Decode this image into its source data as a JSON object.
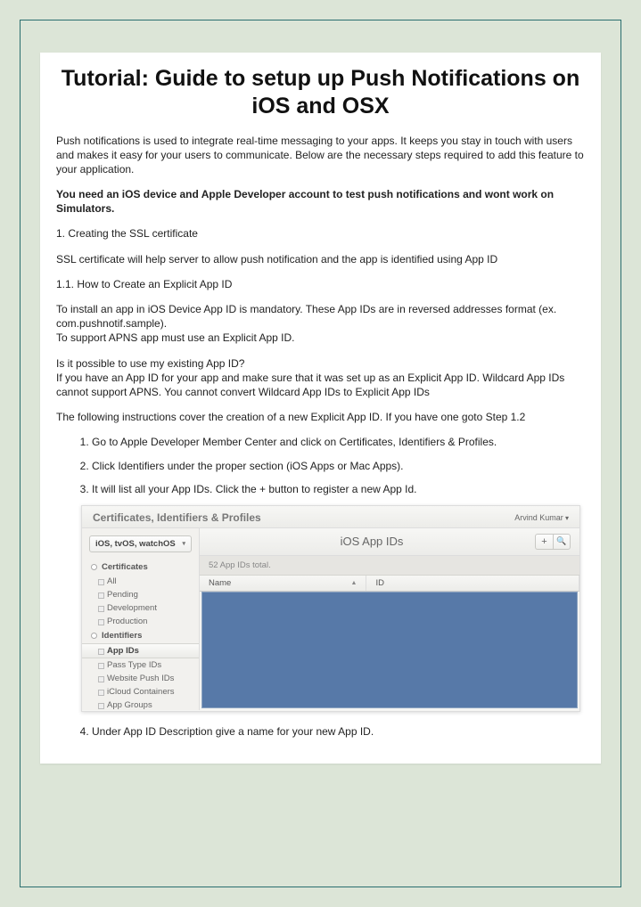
{
  "title": "Tutorial: Guide to setup up Push Notifications on iOS and OSX",
  "intro": "Push notifications is used to integrate real-time messaging to your apps. It keeps you stay in touch with users and makes it easy for your users to communicate. Below are the necessary steps required to add this feature to your application.",
  "requirement": "You need an iOS device and Apple Developer account to test push notifications and wont work on Simulators",
  "section1": "1. Creating the SSL certificate",
  "section1_desc": "SSL certificate will help server to allow push notification and the app is identified using App ID",
  "section1_1": "1.1. How to Create an Explicit App ID",
  "install_line1": "To install an app in iOS Device App ID is mandatory. These App IDs are in reversed addresses format (ex. com.pushnotif.sample).",
  "install_line2": "To support APNS app must use an Explicit App ID.",
  "existing_q1": "Is it possible to use my existing App ID?",
  "existing_q2": "If you have an App ID for your app and make sure that it was set up as an Explicit App ID. Wildcard App IDs cannot support APNS. You cannot convert Wildcard App IDs to Explicit App IDs",
  "following": "The following instructions cover the creation of a new Explicit App ID. If you have one goto Step 1.2",
  "steps": [
    "Go to Apple Developer Member Center and click on Certificates, Identifiers & Profiles.",
    "Click Identifiers under the proper section (iOS Apps or Mac Apps).",
    "It will list all your App IDs. Click the + button to register a new App Id."
  ],
  "step4": "Under App ID Description give a name for your new App ID.",
  "screenshot": {
    "header_title": "Certificates, Identifiers & Profiles",
    "user": "Arvind Kumar",
    "dropdown": "iOS, tvOS, watchOS",
    "sidebar": {
      "certificates": "Certificates",
      "cert_items": [
        "All",
        "Pending",
        "Development",
        "Production"
      ],
      "identifiers": "Identifiers",
      "id_items": [
        "App IDs",
        "Pass Type IDs",
        "Website Push IDs",
        "iCloud Containers",
        "App Groups"
      ]
    },
    "main_title": "iOS App IDs",
    "count": "52  App IDs total.",
    "columns": {
      "name": "Name",
      "id": "ID"
    }
  }
}
